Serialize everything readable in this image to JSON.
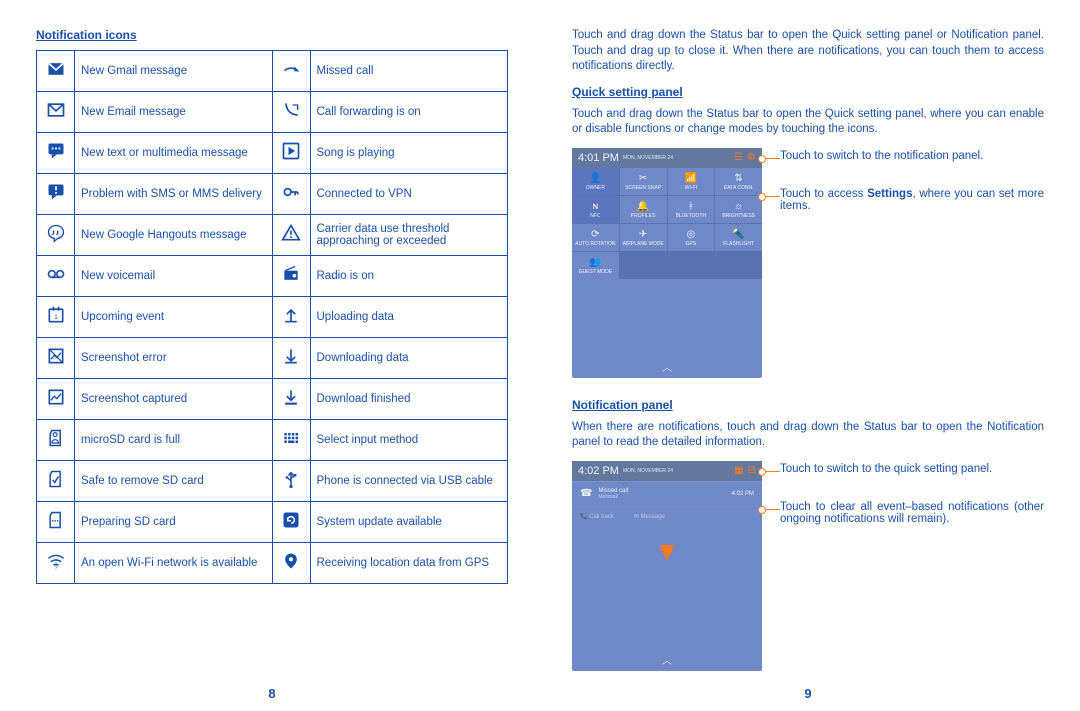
{
  "left": {
    "heading": "Notification icons",
    "page_number": "8",
    "icons": {
      "gmail": {
        "label": "New Gmail message",
        "icon": "gmail-icon",
        "glyph": "✉"
      },
      "email": {
        "label": "New Email message",
        "icon": "email-icon",
        "glyph": "✉"
      },
      "sms": {
        "label": "New text or multimedia message",
        "icon": "sms-icon",
        "glyph": "🗨"
      },
      "sms_err": {
        "label": "Problem with SMS or MMS delivery",
        "icon": "sms-error-icon",
        "glyph": "⚠"
      },
      "hangouts": {
        "label": "New Google Hangouts message",
        "icon": "hangouts-icon",
        "glyph": "❝"
      },
      "voicemail": {
        "label": "New voicemail",
        "icon": "voicemail-icon",
        "glyph": "◌◌"
      },
      "event": {
        "label": "Upcoming event",
        "icon": "calendar-icon",
        "glyph": "🗓"
      },
      "shot_err": {
        "label": "Screenshot error",
        "icon": "screenshot-err-icon",
        "glyph": "⧉"
      },
      "shot_ok": {
        "label": "Screenshot captured",
        "icon": "screenshot-icon",
        "glyph": "🖼"
      },
      "sd_full": {
        "label": "microSD card is full",
        "icon": "sd-full-icon",
        "glyph": "⛶"
      },
      "sd_safe": {
        "label": "Safe to remove SD card",
        "icon": "sd-safe-icon",
        "glyph": "⛶"
      },
      "sd_prep": {
        "label": "Preparing SD card",
        "icon": "sd-prep-icon",
        "glyph": "⛶"
      },
      "wifi_open": {
        "label": "An open Wi-Fi network is available",
        "icon": "wifi-open-icon",
        "glyph": ""
      },
      "missed": {
        "label": "Missed call",
        "icon": "missed-call-icon",
        "glyph": "☎"
      },
      "fwd": {
        "label": "Call forwarding is on",
        "icon": "call-fwd-icon",
        "glyph": "☎"
      },
      "song": {
        "label": "Song is playing",
        "icon": "play-icon",
        "glyph": "▶"
      },
      "vpn": {
        "label": "Connected to VPN",
        "icon": "vpn-icon",
        "glyph": "🔑"
      },
      "data_warn": {
        "label": "Carrier data use threshold approaching or exceeded",
        "icon": "warning-icon",
        "glyph": "△"
      },
      "radio": {
        "label": "Radio is on",
        "icon": "radio-icon",
        "glyph": "📻"
      },
      "upload": {
        "label": "Uploading data",
        "icon": "upload-icon",
        "glyph": "↥"
      },
      "download": {
        "label": "Downloading data",
        "icon": "download-icon",
        "glyph": "↧"
      },
      "dl_done": {
        "label": "Download finished",
        "icon": "download-done-icon",
        "glyph": "↧"
      },
      "input": {
        "label": "Select input method",
        "icon": "keyboard-icon",
        "glyph": "⌨"
      },
      "usb": {
        "label": "Phone is connected via USB cable",
        "icon": "usb-icon",
        "glyph": "Ψ"
      },
      "update": {
        "label": "System update available",
        "icon": "update-icon",
        "glyph": "↻"
      },
      "gps": {
        "label": "Receiving location data from GPS",
        "icon": "gps-icon",
        "glyph": "📍"
      }
    }
  },
  "right": {
    "page_number": "9",
    "intro": "Touch and drag down the Status bar to open the Quick setting panel or Notification panel. Touch and drag up to close it. When there are notifications, you can touch them to access notifications directly.",
    "quick_heading": "Quick setting panel",
    "quick_desc": "Touch and drag down the Status bar to open the Quick setting panel, where you can enable or disable functions or change modes by touching the icons.",
    "quick_callout1": "Touch to switch to the notification panel.",
    "quick_callout2_pre": "Touch to access ",
    "quick_callout2_bold": "Settings",
    "quick_callout2_post": ", where you can set more items.",
    "notif_heading": "Notification panel",
    "notif_desc": "When there are notifications, touch and drag down the Status bar to open the Notification panel to read the detailed information.",
    "notif_callout1": "Touch to switch to the quick setting panel.",
    "notif_callout2": "Touch to clear all event–based notifications (other ongoing notifications will remain).",
    "quick_shot": {
      "time": "4:01 PM",
      "date": "MON, NOVEMBER 24",
      "tiles": [
        {
          "label": "OWNER",
          "glyph": "👤"
        },
        {
          "label": "SCREEN SNAP",
          "glyph": "✂"
        },
        {
          "label": "WI-FI",
          "glyph": "📶"
        },
        {
          "label": "DATA CONN.",
          "glyph": "⇅"
        },
        {
          "label": "NFC",
          "glyph": "ɴ"
        },
        {
          "label": "PROFILES",
          "glyph": "🔔"
        },
        {
          "label": "BLUETOOTH",
          "glyph": "ᚼ"
        },
        {
          "label": "BRIGHTNESS",
          "glyph": "☼"
        },
        {
          "label": "AUTO ROTATION",
          "glyph": "⟳"
        },
        {
          "label": "AIRPLANE MODE",
          "glyph": "✈"
        },
        {
          "label": "GPS",
          "glyph": "◎"
        },
        {
          "label": "FLASHLIGHT",
          "glyph": "🔦"
        },
        {
          "label": "GUEST MODE",
          "glyph": "👥"
        }
      ]
    },
    "notif_shot": {
      "time": "4:02 PM",
      "date": "MON, NOVEMBER 24",
      "row1_title": "Missed call",
      "row1_sub": "Melissa2",
      "row1_time": "4:02 PM",
      "action1": "Call back",
      "action2": "Message"
    }
  }
}
